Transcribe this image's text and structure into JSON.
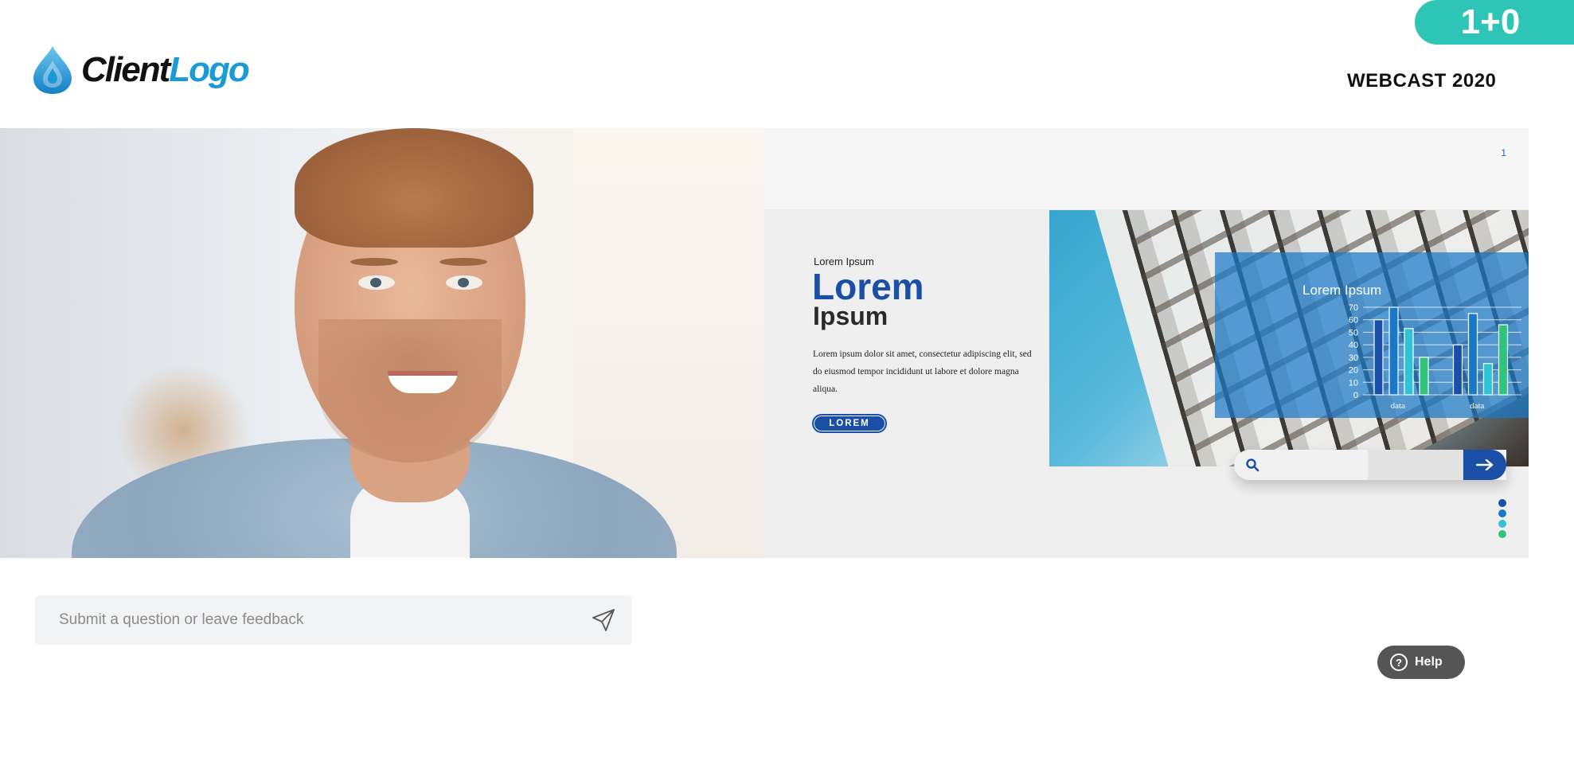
{
  "counter_badge": "1+0",
  "logo": {
    "part1": "Client",
    "part2": "Logo"
  },
  "webcast_title": "WEBCAST 2020",
  "slide": {
    "number": "1",
    "kicker": "Lorem Ipsum",
    "title_line1": "Lorem",
    "title_line2": "Ipsum",
    "body": "Lorem ipsum dolor sit amet, consectetur adipiscing elit, sed do eiusmod tempor incididunt ut labore et dolore magna aliqua.",
    "button_label": "LOREM",
    "dots": [
      "#1a4fa8",
      "#1a78c8",
      "#2ec4d6",
      "#2ec47a"
    ]
  },
  "chart_data": {
    "type": "bar",
    "title": "Lorem Ipsum",
    "categories": [
      "data",
      "data"
    ],
    "y_ticks": [
      "70",
      "60",
      "50",
      "40",
      "30",
      "20",
      "10",
      "0"
    ],
    "ylim": [
      0,
      70
    ],
    "series": [
      {
        "values": [
          60,
          40
        ],
        "color": "#1a4fa8"
      },
      {
        "values": [
          70,
          65
        ],
        "color": "#1a78c8"
      },
      {
        "values": [
          53,
          25
        ],
        "color": "#2ec4d6"
      },
      {
        "values": [
          30,
          56
        ],
        "color": "#2ec47a"
      }
    ]
  },
  "feedback": {
    "placeholder": "Submit a question or leave feedback"
  },
  "help_label": "Help",
  "icons": {
    "logo": "water-drop-icon",
    "send": "paper-plane-icon",
    "search": "search-icon",
    "arrow": "arrow-right-icon",
    "help": "question-circle-icon"
  },
  "colors": {
    "accent": "#2ec4b6",
    "brand_blue": "#1a4fa8",
    "logo_blue": "#1a9ad6"
  }
}
